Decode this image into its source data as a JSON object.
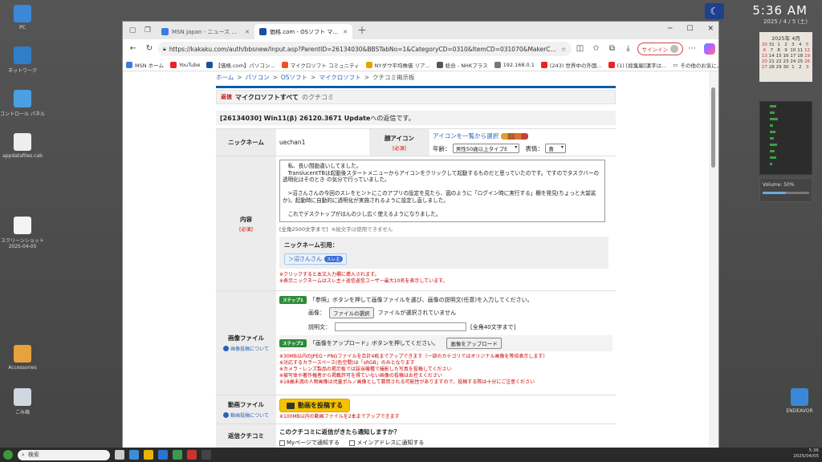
{
  "desktop": {
    "clock": {
      "time": "5:36 AM",
      "date": "2025 / 4 / 5 (土)"
    },
    "icons": [
      {
        "label": "PC"
      },
      {
        "label": "ネットワーク"
      },
      {
        "label": "コントロール パネル"
      },
      {
        "label": "appdatafiles.cab"
      },
      {
        "label": "スクリーンショット 2025-04-05"
      },
      {
        "label": "Accessories"
      },
      {
        "label": "ごみ箱"
      },
      {
        "label": "ENDEAVOR"
      }
    ],
    "calendar": {
      "title": "2025年 4月",
      "days": [
        "30",
        "31",
        "1",
        "2",
        "3",
        "4",
        "5",
        "6",
        "7",
        "8",
        "9",
        "10",
        "11",
        "12",
        "13",
        "14",
        "15",
        "16",
        "17",
        "18",
        "19",
        "20",
        "21",
        "22",
        "23",
        "24",
        "25",
        "26",
        "27",
        "28",
        "29",
        "30",
        "1",
        "2",
        "3"
      ]
    },
    "volume": "Volume: 50%"
  },
  "browser": {
    "tabs": [
      {
        "label": "MSN Japan - ニュース 天気 メール",
        "color": "#3b7de0"
      },
      {
        "label": "価格.com - OSソフト マイクロソフト",
        "color": "#1c4fa0"
      }
    ],
    "url": "https://kakaku.com/auth/bbsnew/Input.asp?ParentID=26134030&BBSTabNo=1&CategoryCD=0310&ItemCD=031070&MakerCD=121...",
    "signin": "サインイン",
    "bookmarks": [
      {
        "label": "MSN ホーム",
        "color": "#3b7de0"
      },
      {
        "label": "YouTube",
        "color": "#e22"
      },
      {
        "label": "【価格.com】パソコン...",
        "color": "#1c4fa0"
      },
      {
        "label": "マイクロソフト コミュニティ",
        "color": "#f25022"
      },
      {
        "label": "NYダウ平均株価 リア...",
        "color": "#e8a300"
      },
      {
        "label": "総合 - NHKプラス",
        "color": "#555"
      },
      {
        "label": "192.168.0.1",
        "color": "#777"
      },
      {
        "label": "(243) 世界中の外国...",
        "color": "#e22"
      },
      {
        "label": "(1) [総集編]漢字は...",
        "color": "#e22"
      }
    ],
    "bookmarks_right": "その他のお気に入り"
  },
  "page": {
    "breadcrumb": [
      "ホーム",
      "パソコン",
      "OSソフト",
      "マイクロソフト",
      "クチコミ掲示板"
    ],
    "reply_tag": "返信",
    "reply_title": "マイクロソフトすべて",
    "reply_sub": "のクチコミ",
    "thread_title": "[26134030] Win11(β) 26120.3671 Update",
    "thread_suffix": "への返信です。",
    "nick_label": "ニックネーム",
    "nick_value": "uechan1",
    "face_label": "顔アイコン",
    "required": "[必須]",
    "face_link": "アイコンを一覧から選択",
    "age_label": "年齢：",
    "age_value": "男性50歳以上タイプE",
    "expr_label": "表情：",
    "expr_value": "喜",
    "body_label": "内容",
    "body_text": "　私、長い間勘違いしてました。\n　TranslucentTBは起動後スタートメニューからアイコンをクリックして起動するものだと思っていたのです。ですのでタスクバーの透明化はそのとき の気分で行っていました。\n\n　>沼さんさんの今回のスレをヒントにこのアプリの設定を見たら、図のように「ログイン時に実行する」欄を発見(ちょっと大袈裟か)。起動時に自動的に透明化が実施されるように設定し直しました。\n\n　これでデスクトップがほんの少し広く使えるようになりました。",
    "char_limit": "[全角2500文字まで]",
    "char_note": "※絵文字は使用できません",
    "quote_title": "ニックネーム引用：",
    "quote_name": "＞沼さんさん",
    "quote_badge": "スレ主",
    "quote_notes": [
      "※クリックすると本文入力欄に挿入されます。",
      "※表示ニックネームはスレ主＋返信返信ユーザー最大10名を表示しています。"
    ],
    "image_label": "画像ファイル",
    "image_hint": "画像投稿について",
    "step1_badge": "ステップ1",
    "step1_text": "「参照」ボタンを押して画像ファイルを選び、画像の説明文(任意)を入力してください。",
    "image_field": "画像：",
    "file_button": "ファイルの選択",
    "file_status": "ファイルが選択されていません",
    "desc_field": "説明文：",
    "desc_limit": "[全角40文字まで]",
    "step2_badge": "ステップ2",
    "step2_text": "「画像をアップロード」ボタンを押してください。",
    "upload_button": "画像をアップロード",
    "image_notes": [
      "※30MB以内のJPEG・PNGファイルを合計4枚までアップできます（一部のカテゴリではオリジナル画像を等倍表示します）",
      "※対応するカラースペース(色空間)は「sRGB」のみとなります",
      "※カメラ・レンズ製品の掲示板では誤当機種で撮影した写真を投稿してください",
      "※被写体や著作権者から掲載許可を得ていない画像の投稿はお控えください",
      "※18歳未満の人物画像は児童ポルノ画像として悪用される可能性がありますので、投稿する際は十分にご注意ください"
    ],
    "video_label": "動画ファイル",
    "video_hint": "動画投稿について",
    "video_button": "動画を投稿する",
    "video_note": "※100MB以内の動画ファイルを2本までアップできます",
    "notify_label": "返信クチコミ",
    "notify_title": "このクチコミに返信がきたら通知しますか？",
    "notify_opt1": "Myページで通知する",
    "notify_opt2": "メインアドレスに通知する"
  },
  "taskbar": {
    "search": "検索",
    "time": "5:36",
    "date": "2025/04/05"
  }
}
